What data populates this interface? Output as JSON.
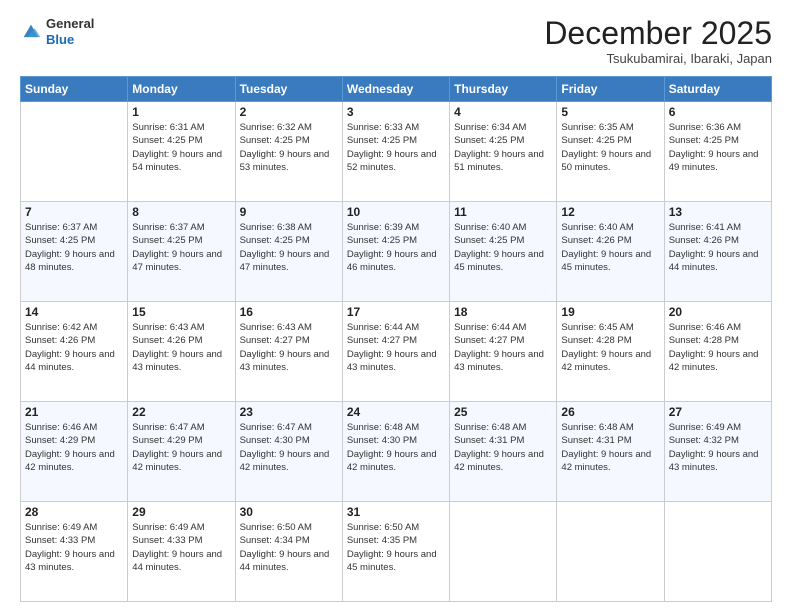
{
  "logo": {
    "general": "General",
    "blue": "Blue"
  },
  "header": {
    "month": "December 2025",
    "location": "Tsukubamirai, Ibaraki, Japan"
  },
  "weekdays": [
    "Sunday",
    "Monday",
    "Tuesday",
    "Wednesday",
    "Thursday",
    "Friday",
    "Saturday"
  ],
  "weeks": [
    [
      {
        "day": "",
        "sunrise": "",
        "sunset": "",
        "daylight": ""
      },
      {
        "day": "1",
        "sunrise": "Sunrise: 6:31 AM",
        "sunset": "Sunset: 4:25 PM",
        "daylight": "Daylight: 9 hours and 54 minutes."
      },
      {
        "day": "2",
        "sunrise": "Sunrise: 6:32 AM",
        "sunset": "Sunset: 4:25 PM",
        "daylight": "Daylight: 9 hours and 53 minutes."
      },
      {
        "day": "3",
        "sunrise": "Sunrise: 6:33 AM",
        "sunset": "Sunset: 4:25 PM",
        "daylight": "Daylight: 9 hours and 52 minutes."
      },
      {
        "day": "4",
        "sunrise": "Sunrise: 6:34 AM",
        "sunset": "Sunset: 4:25 PM",
        "daylight": "Daylight: 9 hours and 51 minutes."
      },
      {
        "day": "5",
        "sunrise": "Sunrise: 6:35 AM",
        "sunset": "Sunset: 4:25 PM",
        "daylight": "Daylight: 9 hours and 50 minutes."
      },
      {
        "day": "6",
        "sunrise": "Sunrise: 6:36 AM",
        "sunset": "Sunset: 4:25 PM",
        "daylight": "Daylight: 9 hours and 49 minutes."
      }
    ],
    [
      {
        "day": "7",
        "sunrise": "Sunrise: 6:37 AM",
        "sunset": "Sunset: 4:25 PM",
        "daylight": "Daylight: 9 hours and 48 minutes."
      },
      {
        "day": "8",
        "sunrise": "Sunrise: 6:37 AM",
        "sunset": "Sunset: 4:25 PM",
        "daylight": "Daylight: 9 hours and 47 minutes."
      },
      {
        "day": "9",
        "sunrise": "Sunrise: 6:38 AM",
        "sunset": "Sunset: 4:25 PM",
        "daylight": "Daylight: 9 hours and 47 minutes."
      },
      {
        "day": "10",
        "sunrise": "Sunrise: 6:39 AM",
        "sunset": "Sunset: 4:25 PM",
        "daylight": "Daylight: 9 hours and 46 minutes."
      },
      {
        "day": "11",
        "sunrise": "Sunrise: 6:40 AM",
        "sunset": "Sunset: 4:25 PM",
        "daylight": "Daylight: 9 hours and 45 minutes."
      },
      {
        "day": "12",
        "sunrise": "Sunrise: 6:40 AM",
        "sunset": "Sunset: 4:26 PM",
        "daylight": "Daylight: 9 hours and 45 minutes."
      },
      {
        "day": "13",
        "sunrise": "Sunrise: 6:41 AM",
        "sunset": "Sunset: 4:26 PM",
        "daylight": "Daylight: 9 hours and 44 minutes."
      }
    ],
    [
      {
        "day": "14",
        "sunrise": "Sunrise: 6:42 AM",
        "sunset": "Sunset: 4:26 PM",
        "daylight": "Daylight: 9 hours and 44 minutes."
      },
      {
        "day": "15",
        "sunrise": "Sunrise: 6:43 AM",
        "sunset": "Sunset: 4:26 PM",
        "daylight": "Daylight: 9 hours and 43 minutes."
      },
      {
        "day": "16",
        "sunrise": "Sunrise: 6:43 AM",
        "sunset": "Sunset: 4:27 PM",
        "daylight": "Daylight: 9 hours and 43 minutes."
      },
      {
        "day": "17",
        "sunrise": "Sunrise: 6:44 AM",
        "sunset": "Sunset: 4:27 PM",
        "daylight": "Daylight: 9 hours and 43 minutes."
      },
      {
        "day": "18",
        "sunrise": "Sunrise: 6:44 AM",
        "sunset": "Sunset: 4:27 PM",
        "daylight": "Daylight: 9 hours and 43 minutes."
      },
      {
        "day": "19",
        "sunrise": "Sunrise: 6:45 AM",
        "sunset": "Sunset: 4:28 PM",
        "daylight": "Daylight: 9 hours and 42 minutes."
      },
      {
        "day": "20",
        "sunrise": "Sunrise: 6:46 AM",
        "sunset": "Sunset: 4:28 PM",
        "daylight": "Daylight: 9 hours and 42 minutes."
      }
    ],
    [
      {
        "day": "21",
        "sunrise": "Sunrise: 6:46 AM",
        "sunset": "Sunset: 4:29 PM",
        "daylight": "Daylight: 9 hours and 42 minutes."
      },
      {
        "day": "22",
        "sunrise": "Sunrise: 6:47 AM",
        "sunset": "Sunset: 4:29 PM",
        "daylight": "Daylight: 9 hours and 42 minutes."
      },
      {
        "day": "23",
        "sunrise": "Sunrise: 6:47 AM",
        "sunset": "Sunset: 4:30 PM",
        "daylight": "Daylight: 9 hours and 42 minutes."
      },
      {
        "day": "24",
        "sunrise": "Sunrise: 6:48 AM",
        "sunset": "Sunset: 4:30 PM",
        "daylight": "Daylight: 9 hours and 42 minutes."
      },
      {
        "day": "25",
        "sunrise": "Sunrise: 6:48 AM",
        "sunset": "Sunset: 4:31 PM",
        "daylight": "Daylight: 9 hours and 42 minutes."
      },
      {
        "day": "26",
        "sunrise": "Sunrise: 6:48 AM",
        "sunset": "Sunset: 4:31 PM",
        "daylight": "Daylight: 9 hours and 42 minutes."
      },
      {
        "day": "27",
        "sunrise": "Sunrise: 6:49 AM",
        "sunset": "Sunset: 4:32 PM",
        "daylight": "Daylight: 9 hours and 43 minutes."
      }
    ],
    [
      {
        "day": "28",
        "sunrise": "Sunrise: 6:49 AM",
        "sunset": "Sunset: 4:33 PM",
        "daylight": "Daylight: 9 hours and 43 minutes."
      },
      {
        "day": "29",
        "sunrise": "Sunrise: 6:49 AM",
        "sunset": "Sunset: 4:33 PM",
        "daylight": "Daylight: 9 hours and 44 minutes."
      },
      {
        "day": "30",
        "sunrise": "Sunrise: 6:50 AM",
        "sunset": "Sunset: 4:34 PM",
        "daylight": "Daylight: 9 hours and 44 minutes."
      },
      {
        "day": "31",
        "sunrise": "Sunrise: 6:50 AM",
        "sunset": "Sunset: 4:35 PM",
        "daylight": "Daylight: 9 hours and 45 minutes."
      },
      {
        "day": "",
        "sunrise": "",
        "sunset": "",
        "daylight": ""
      },
      {
        "day": "",
        "sunrise": "",
        "sunset": "",
        "daylight": ""
      },
      {
        "day": "",
        "sunrise": "",
        "sunset": "",
        "daylight": ""
      }
    ]
  ]
}
